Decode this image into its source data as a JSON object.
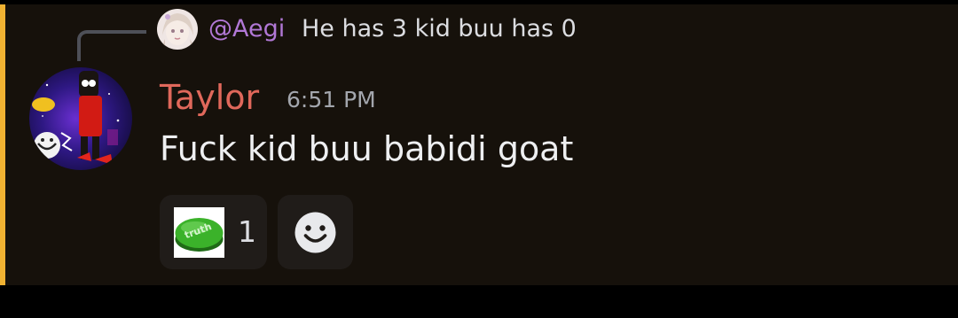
{
  "reply": {
    "author": "@Aegi",
    "text": "He has 3 kid buu has 0",
    "avatar_icon": "anime-character-avatar-icon"
  },
  "message": {
    "author": "Taylor",
    "timestamp": "6:51 PM",
    "content": "Fuck kid buu babidi goat",
    "avatar_icon": "galaxy-collage-avatar-icon"
  },
  "reactions": [
    {
      "emoji_name": "green-truth-button-emoji",
      "emoji_text": "truth",
      "count": "1"
    }
  ],
  "add_reaction_icon": "smiley-face-icon",
  "colors": {
    "background": "#16110b",
    "mention_bar": "#f0b232",
    "reply_author": "#b178d6",
    "author": "#e0685b",
    "timestamp": "#a3a6ad",
    "text": "#eeeff1",
    "reaction_bg": "#201c19"
  }
}
